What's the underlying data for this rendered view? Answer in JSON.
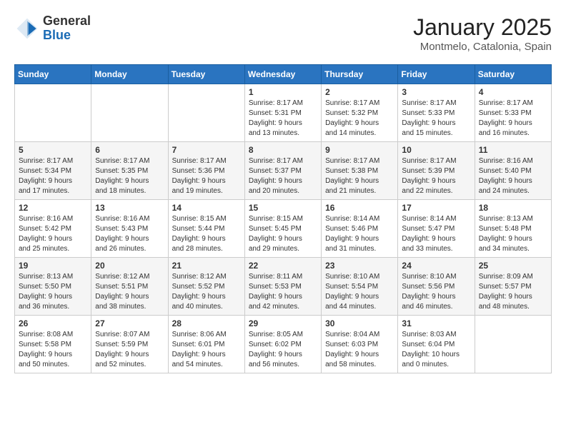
{
  "header": {
    "logo_general": "General",
    "logo_blue": "Blue",
    "month_title": "January 2025",
    "location": "Montmelo, Catalonia, Spain"
  },
  "weekdays": [
    "Sunday",
    "Monday",
    "Tuesday",
    "Wednesday",
    "Thursday",
    "Friday",
    "Saturday"
  ],
  "weeks": [
    [
      {
        "day": "",
        "info": ""
      },
      {
        "day": "",
        "info": ""
      },
      {
        "day": "",
        "info": ""
      },
      {
        "day": "1",
        "info": "Sunrise: 8:17 AM\nSunset: 5:31 PM\nDaylight: 9 hours\nand 13 minutes."
      },
      {
        "day": "2",
        "info": "Sunrise: 8:17 AM\nSunset: 5:32 PM\nDaylight: 9 hours\nand 14 minutes."
      },
      {
        "day": "3",
        "info": "Sunrise: 8:17 AM\nSunset: 5:33 PM\nDaylight: 9 hours\nand 15 minutes."
      },
      {
        "day": "4",
        "info": "Sunrise: 8:17 AM\nSunset: 5:33 PM\nDaylight: 9 hours\nand 16 minutes."
      }
    ],
    [
      {
        "day": "5",
        "info": "Sunrise: 8:17 AM\nSunset: 5:34 PM\nDaylight: 9 hours\nand 17 minutes."
      },
      {
        "day": "6",
        "info": "Sunrise: 8:17 AM\nSunset: 5:35 PM\nDaylight: 9 hours\nand 18 minutes."
      },
      {
        "day": "7",
        "info": "Sunrise: 8:17 AM\nSunset: 5:36 PM\nDaylight: 9 hours\nand 19 minutes."
      },
      {
        "day": "8",
        "info": "Sunrise: 8:17 AM\nSunset: 5:37 PM\nDaylight: 9 hours\nand 20 minutes."
      },
      {
        "day": "9",
        "info": "Sunrise: 8:17 AM\nSunset: 5:38 PM\nDaylight: 9 hours\nand 21 minutes."
      },
      {
        "day": "10",
        "info": "Sunrise: 8:17 AM\nSunset: 5:39 PM\nDaylight: 9 hours\nand 22 minutes."
      },
      {
        "day": "11",
        "info": "Sunrise: 8:16 AM\nSunset: 5:40 PM\nDaylight: 9 hours\nand 24 minutes."
      }
    ],
    [
      {
        "day": "12",
        "info": "Sunrise: 8:16 AM\nSunset: 5:42 PM\nDaylight: 9 hours\nand 25 minutes."
      },
      {
        "day": "13",
        "info": "Sunrise: 8:16 AM\nSunset: 5:43 PM\nDaylight: 9 hours\nand 26 minutes."
      },
      {
        "day": "14",
        "info": "Sunrise: 8:15 AM\nSunset: 5:44 PM\nDaylight: 9 hours\nand 28 minutes."
      },
      {
        "day": "15",
        "info": "Sunrise: 8:15 AM\nSunset: 5:45 PM\nDaylight: 9 hours\nand 29 minutes."
      },
      {
        "day": "16",
        "info": "Sunrise: 8:14 AM\nSunset: 5:46 PM\nDaylight: 9 hours\nand 31 minutes."
      },
      {
        "day": "17",
        "info": "Sunrise: 8:14 AM\nSunset: 5:47 PM\nDaylight: 9 hours\nand 33 minutes."
      },
      {
        "day": "18",
        "info": "Sunrise: 8:13 AM\nSunset: 5:48 PM\nDaylight: 9 hours\nand 34 minutes."
      }
    ],
    [
      {
        "day": "19",
        "info": "Sunrise: 8:13 AM\nSunset: 5:50 PM\nDaylight: 9 hours\nand 36 minutes."
      },
      {
        "day": "20",
        "info": "Sunrise: 8:12 AM\nSunset: 5:51 PM\nDaylight: 9 hours\nand 38 minutes."
      },
      {
        "day": "21",
        "info": "Sunrise: 8:12 AM\nSunset: 5:52 PM\nDaylight: 9 hours\nand 40 minutes."
      },
      {
        "day": "22",
        "info": "Sunrise: 8:11 AM\nSunset: 5:53 PM\nDaylight: 9 hours\nand 42 minutes."
      },
      {
        "day": "23",
        "info": "Sunrise: 8:10 AM\nSunset: 5:54 PM\nDaylight: 9 hours\nand 44 minutes."
      },
      {
        "day": "24",
        "info": "Sunrise: 8:10 AM\nSunset: 5:56 PM\nDaylight: 9 hours\nand 46 minutes."
      },
      {
        "day": "25",
        "info": "Sunrise: 8:09 AM\nSunset: 5:57 PM\nDaylight: 9 hours\nand 48 minutes."
      }
    ],
    [
      {
        "day": "26",
        "info": "Sunrise: 8:08 AM\nSunset: 5:58 PM\nDaylight: 9 hours\nand 50 minutes."
      },
      {
        "day": "27",
        "info": "Sunrise: 8:07 AM\nSunset: 5:59 PM\nDaylight: 9 hours\nand 52 minutes."
      },
      {
        "day": "28",
        "info": "Sunrise: 8:06 AM\nSunset: 6:01 PM\nDaylight: 9 hours\nand 54 minutes."
      },
      {
        "day": "29",
        "info": "Sunrise: 8:05 AM\nSunset: 6:02 PM\nDaylight: 9 hours\nand 56 minutes."
      },
      {
        "day": "30",
        "info": "Sunrise: 8:04 AM\nSunset: 6:03 PM\nDaylight: 9 hours\nand 58 minutes."
      },
      {
        "day": "31",
        "info": "Sunrise: 8:03 AM\nSunset: 6:04 PM\nDaylight: 10 hours\nand 0 minutes."
      },
      {
        "day": "",
        "info": ""
      }
    ]
  ]
}
